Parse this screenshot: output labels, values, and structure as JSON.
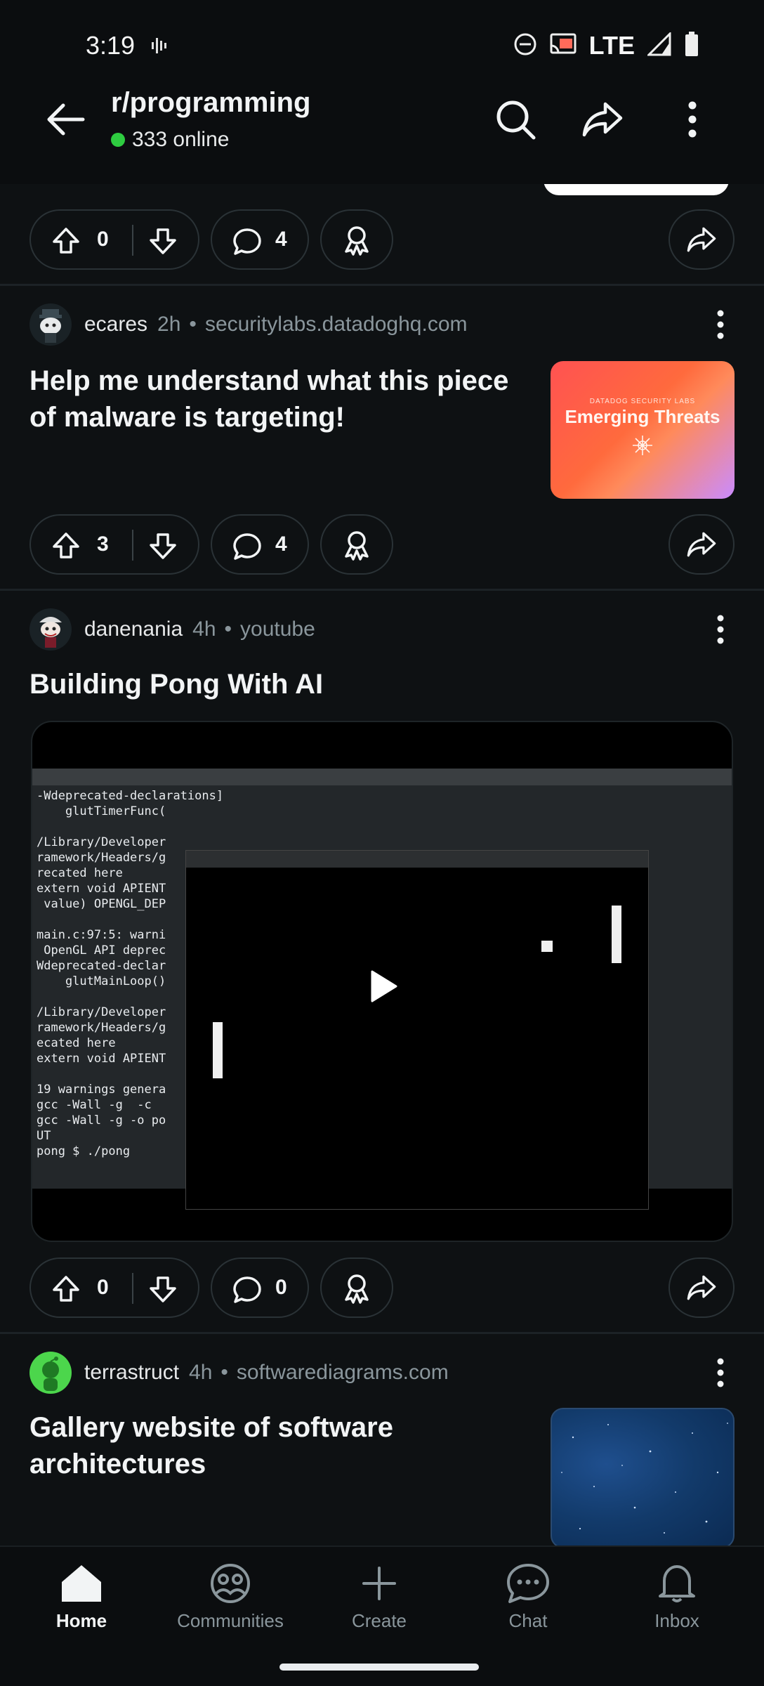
{
  "status_bar": {
    "time": "3:19",
    "network": "LTE"
  },
  "header": {
    "subreddit": "r/programming",
    "online_text": "333 online"
  },
  "posts": [
    {
      "upvotes": "0",
      "comments": "4"
    },
    {
      "author": "ecares",
      "age": "2h",
      "domain": "securitylabs.datadoghq.com",
      "title": "Help me understand what this piece of malware is targeting!",
      "thumbnail": {
        "small_text": "DATADOG SECURITY LABS",
        "big_text": "Emerging Threats"
      },
      "upvotes": "3",
      "comments": "4"
    },
    {
      "author": "danenania",
      "age": "4h",
      "domain": "youtube",
      "title": "Building Pong With AI",
      "upvotes": "0",
      "comments": "0"
    },
    {
      "author": "terrastruct",
      "age": "4h",
      "domain": "softwarediagrams.com",
      "title": "Gallery website of software architectures"
    }
  ],
  "video_terminal_lines": [
    "-Wdeprecated-declarations]",
    "    glutTimerFunc(",
    "",
    "/Library/Developer",
    "ramework/Headers/g",
    "recated here",
    "extern void APIENT",
    " value) OPENGL_DEP",
    "",
    "main.c:97:5: warni",
    " OpenGL API deprec",
    "Wdeprecated-declar",
    "    glutMainLoop()",
    "",
    "/Library/Developer",
    "ramework/Headers/g",
    "ecated here",
    "extern void APIENT",
    "",
    "19 warnings genera",
    "gcc -Wall -g  -c",
    "gcc -Wall -g -o po",
    "UT",
    "pong $ ./pong"
  ],
  "bottom_nav": [
    {
      "label": "Home",
      "icon": "home-icon",
      "active": true
    },
    {
      "label": "Communities",
      "icon": "communities-icon"
    },
    {
      "label": "Create",
      "icon": "plus-icon"
    },
    {
      "label": "Chat",
      "icon": "chat-icon"
    },
    {
      "label": "Inbox",
      "icon": "bell-icon"
    }
  ],
  "colors": {
    "background": "#0e1113",
    "online_dot": "#2ecc40",
    "muted_text": "#8a969c"
  }
}
